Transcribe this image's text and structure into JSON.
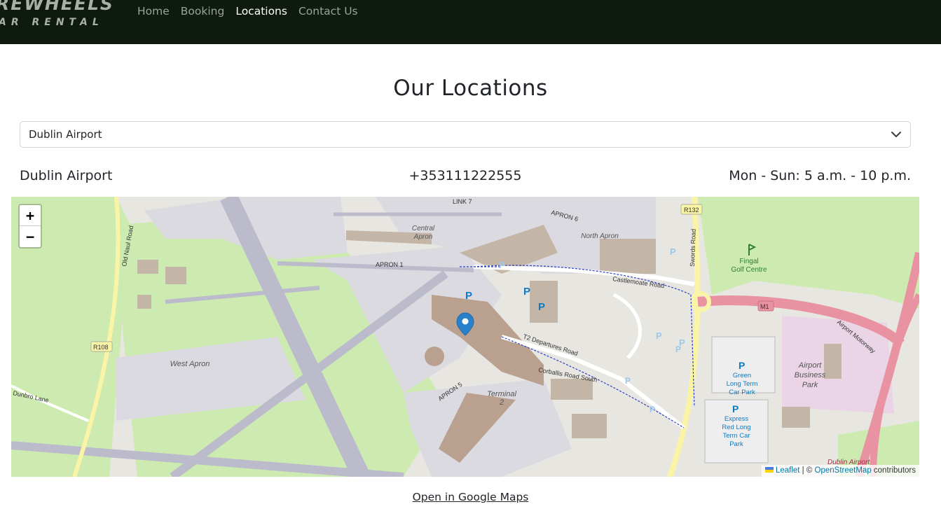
{
  "navbar": {
    "brand_top": "REWHEELS",
    "brand_bottom": "AR RENTAL",
    "links": [
      {
        "label": "Home",
        "active": false
      },
      {
        "label": "Booking",
        "active": false
      },
      {
        "label": "Locations",
        "active": true
      },
      {
        "label": "Contact Us",
        "active": false
      }
    ]
  },
  "page": {
    "title": "Our Locations"
  },
  "location_select": {
    "value": "Dublin Airport",
    "icon": "chevron-down-icon"
  },
  "location_info": {
    "name": "Dublin Airport",
    "phone": "+353111222555",
    "hours": "Mon - Sun: 5 a.m. - 10 p.m."
  },
  "map": {
    "zoom_in": "+",
    "zoom_out": "−",
    "attribution": {
      "leaflet": "Leaflet",
      "separator": " | © ",
      "osm": "OpenStreetMap",
      "suffix": " contributors"
    },
    "labels": {
      "central_apron_1": "Central",
      "central_apron_1b": "Apron",
      "north_apron": "North Apron",
      "west_apron": "West Apron",
      "terminal": "Terminal",
      "terminal_num": "2",
      "fingal": "Fingal",
      "golf_centre": "Golf Centre",
      "airport_business": "Airport",
      "business": "Business",
      "park": "Park",
      "green_long": "Green",
      "long_term": "Long Term",
      "car_park": "Car Park",
      "express": "Express",
      "red_long": "Red Long",
      "term_car": "Term Car",
      "park2": "Park",
      "castlemoate": "Castlemoate Road",
      "swords_road": "Swords Road",
      "airport_motorway": "Airport Motorway",
      "r132": "R132",
      "r108": "R108",
      "m1": "M1",
      "old_naul": "Old Naul Road",
      "dunbro": "Dunbro Lane",
      "dublin_airport": "Dublin Airport",
      "t2_departures": "T2 Departures Road",
      "corballis": "Corballis Road South",
      "apron1": "APRON 1",
      "apron5": "APRON 5",
      "apron6": "APRON 6",
      "link7": "LINK 7",
      "parking": "P"
    },
    "colors": {
      "land": "#e8e6e1",
      "grass": "#cdebb0",
      "apron": "#dadae0",
      "runway": "#bbbbcc",
      "building": "#c4b6a6",
      "terminal": "#b9a08f",
      "motorway": "#e892a2",
      "primary": "#f9f4a6",
      "marker": "#2a81cb",
      "parking": "#0d7bc4"
    }
  },
  "footer": {
    "google_maps_link": "Open in Google Maps"
  }
}
